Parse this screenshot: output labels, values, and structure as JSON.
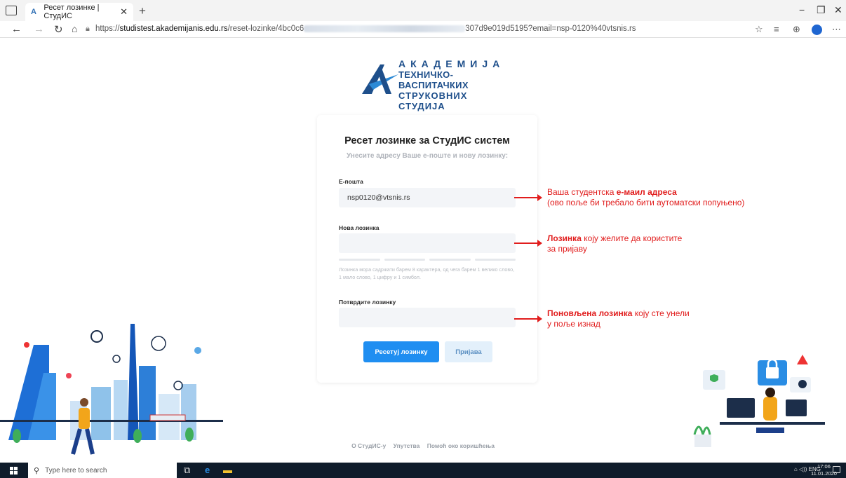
{
  "browser": {
    "tab_title": "Ресет лозинке | СтудИС",
    "url_prefix": "https://",
    "url_host": "studistest.akademijanis.edu.rs",
    "url_path": "/reset-lozinke/4bc0c6",
    "url_suffix": "307d9e019d5195?email=nsp-0120%40vtsnis.rs"
  },
  "logo": {
    "line1": "АКАДЕМИЈА",
    "line2": "ТЕХНИЧКО-ВАСПИТАЧКИХ",
    "line3": "СТРУКОВНИХ СТУДИЈА"
  },
  "form": {
    "title": "Ресет лозинке за СтудИС систем",
    "subtitle": "Унесите адресу Ваше е-поште и нову лозинку:",
    "email_label": "Е-пошта",
    "email_value": "nsp0120@vtsnis.rs",
    "password_label": "Нова лозинка",
    "password_hint": "Лозинка мора садржати барем 8 карактера, од чега барем 1 велико слово, 1 мало слово, 1 цифру и 1 симбол.",
    "confirm_label": "Потврдите лозинку",
    "reset_button": "Ресетуј лозинку",
    "login_button": "Пријава"
  },
  "annotations": {
    "email_pre": "Ваша студентска ",
    "email_bold": "е-маил адреса",
    "email_line2": "(ово поље би требало бити аутоматски попуњено)",
    "password_bold": "Лозинка",
    "password_post": " коју желите да користите",
    "password_line2": "за пријаву",
    "confirm_bold": "Поновљена лозинка",
    "confirm_post": " коју сте унели",
    "confirm_line2": "у поље изнад"
  },
  "footer": {
    "about": "О СтудИС-у",
    "guide": "Упутства",
    "help": "Помоћ око коришћења"
  },
  "taskbar": {
    "search_placeholder": "Type here to search",
    "language": "ENG",
    "time": "17:06",
    "date": "11.01.2020"
  },
  "colors": {
    "accent": "#1f8ef1",
    "annotation": "#e11d1d",
    "logo": "#1e4f8b"
  }
}
